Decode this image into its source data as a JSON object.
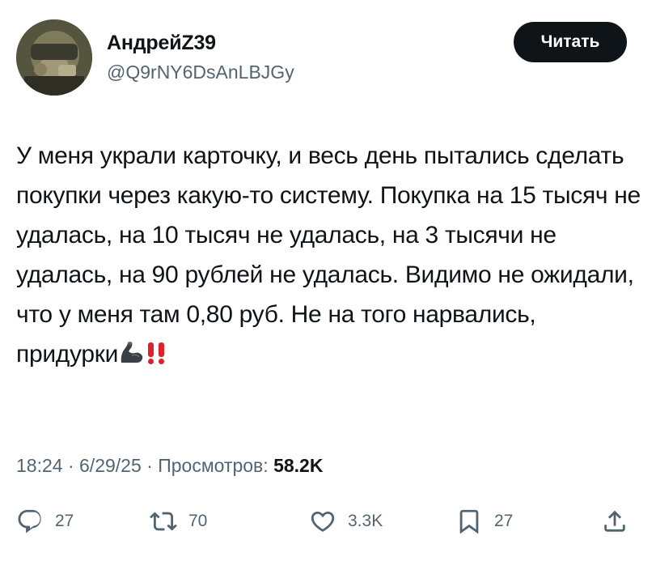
{
  "author": {
    "display_name": "АндрейZ39",
    "handle": "@Q9rNY6DsAnLBJGy"
  },
  "follow_button": {
    "label": "Читать"
  },
  "tweet": {
    "text": "У меня украли карточку, и весь день пытались сделать покупки через какую-то систему. Покупка на 15 тысяч не удалась, на 10 тысяч не удалась, на 3 тысячи не удалась, на 90 рублей не удалась. Видимо не ожидали, что у меня там 0,80 руб. Не на того нарвались, придурки",
    "emojis": [
      "flexed-biceps",
      "double-exclamation"
    ]
  },
  "meta": {
    "time": "18:24",
    "separator": "·",
    "date": "6/29/25",
    "views_label": "Просмотров:",
    "views_count": "58.2K"
  },
  "actions": {
    "replies": "27",
    "retweets": "70",
    "likes": "3.3K",
    "bookmarks": "27"
  },
  "colors": {
    "text_primary": "#0f1419",
    "text_secondary": "#536471",
    "button_bg": "#0f1419",
    "button_text": "#ffffff",
    "emoji_red": "#e0202b"
  }
}
